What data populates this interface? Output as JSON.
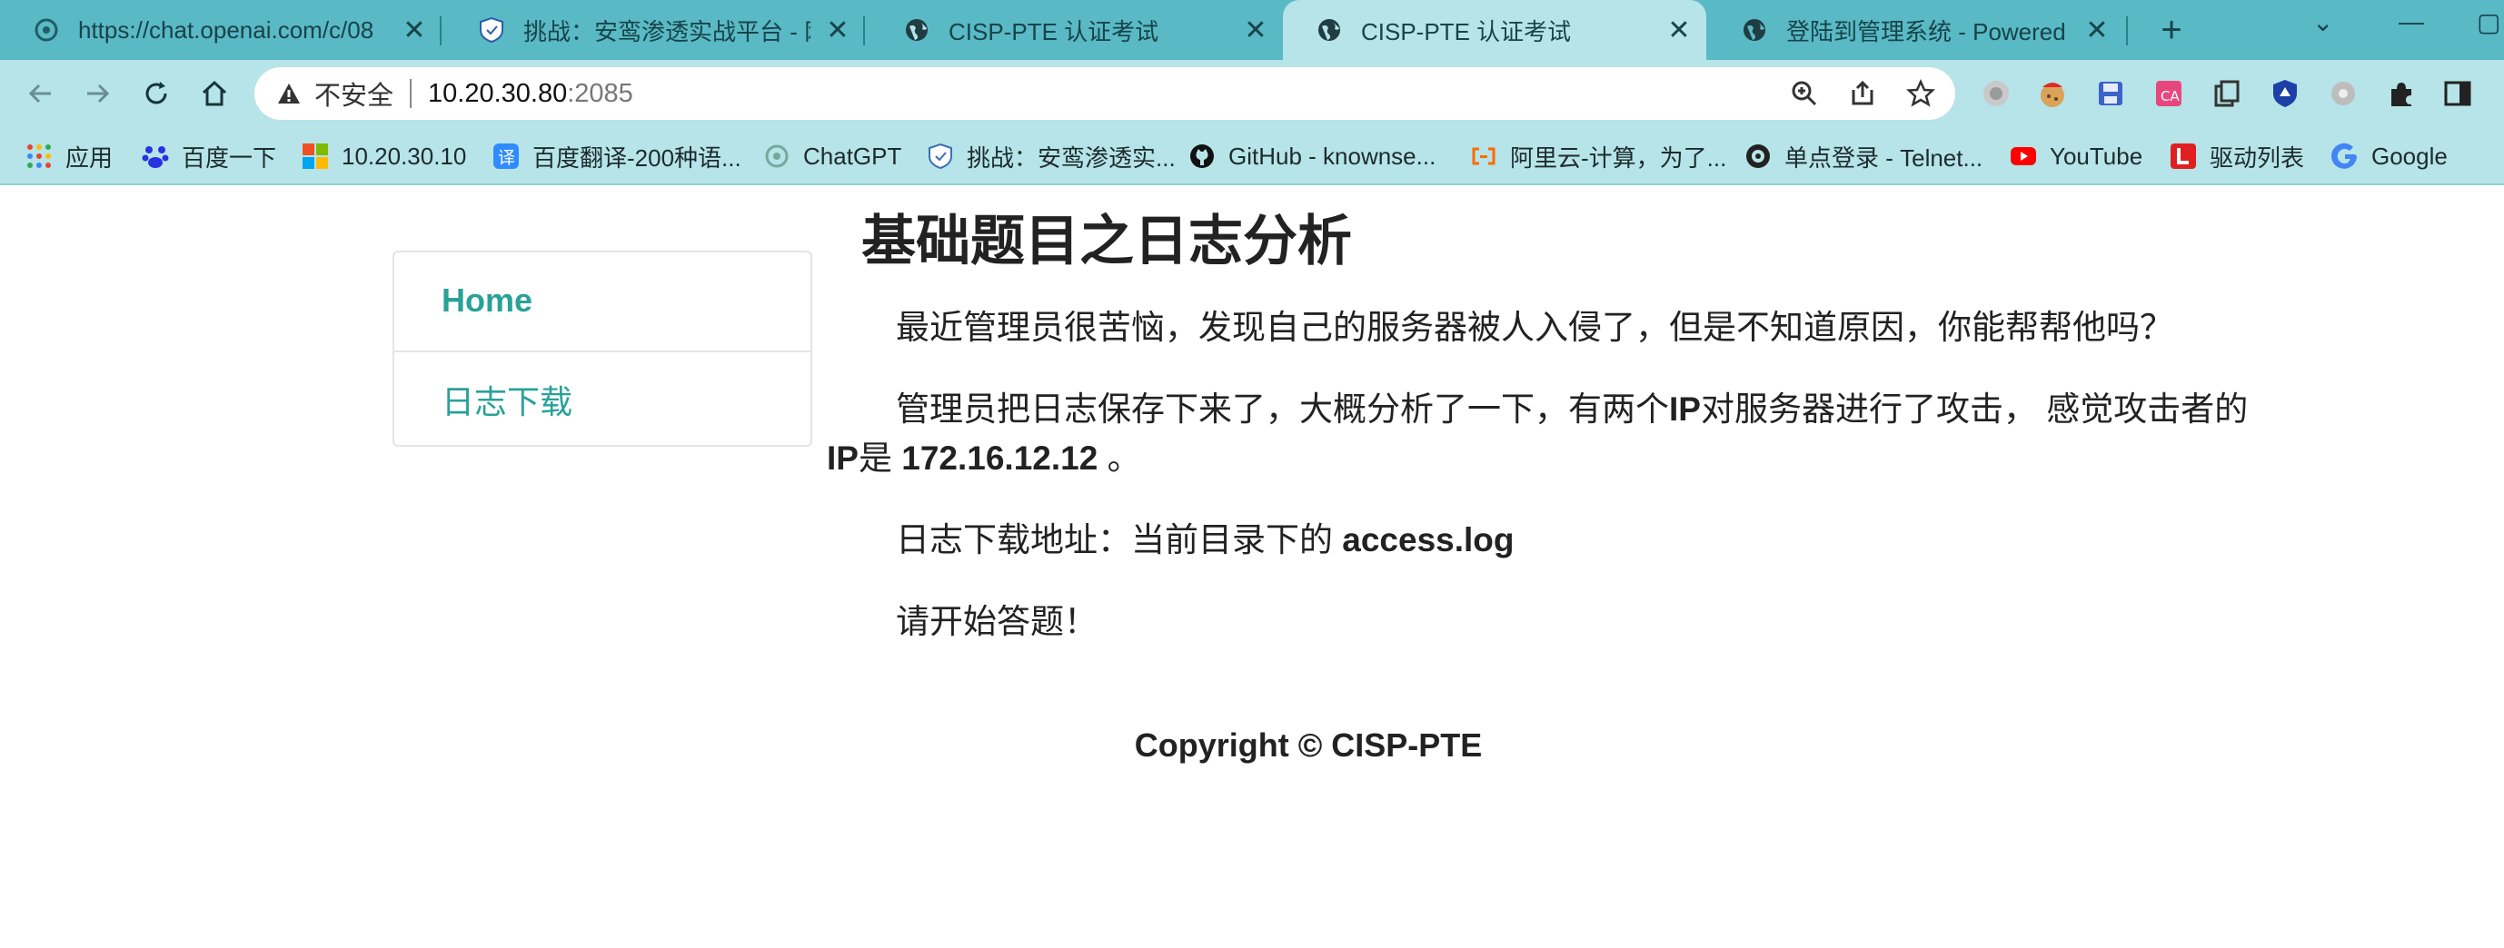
{
  "browser": {
    "tabs": [
      {
        "title": "https://chat.openai.com/c/08",
        "icon": "openai-icon",
        "active": false
      },
      {
        "title": "挑战：安鸾渗透实战平台 - 网络",
        "icon": "shield-icon",
        "active": false
      },
      {
        "title": "CISP-PTE 认证考试",
        "icon": "globe-icon",
        "active": false
      },
      {
        "title": "CISP-PTE 认证考试",
        "icon": "globe-icon",
        "active": true
      },
      {
        "title": "登陆到管理系统 - Powered by",
        "icon": "globe-icon",
        "active": false
      }
    ],
    "new_tab": "+",
    "address": {
      "security_label": "不安全",
      "host": "10.20.30.80",
      "port": ":2085"
    },
    "bookmarks": [
      {
        "label": "应用",
        "icon": "apps-grid-icon",
        "color": "#e94235"
      },
      {
        "label": "百度一下",
        "icon": "baidu-icon",
        "color": "#2932e1"
      },
      {
        "label": "10.20.30.10",
        "icon": "windows-icon",
        "color": "#f25022"
      },
      {
        "label": "百度翻译-200种语...",
        "icon": "baidu-translate-icon",
        "color": "#2f8bff"
      },
      {
        "label": "ChatGPT",
        "icon": "openai-icon",
        "color": "#74aa9c"
      },
      {
        "label": "挑战：安鸾渗透实...",
        "icon": "shield-icon",
        "color": "#3b6fb6"
      },
      {
        "label": "GitHub - knownse...",
        "icon": "github-icon",
        "color": "#111111"
      },
      {
        "label": "阿里云-计算，为了...",
        "icon": "aliyun-icon",
        "color": "#ff6a00"
      },
      {
        "label": "单点登录 - Telnet...",
        "icon": "telnet-icon",
        "color": "#222222"
      },
      {
        "label": "YouTube",
        "icon": "youtube-icon",
        "color": "#ff0000"
      },
      {
        "label": "驱动列表",
        "icon": "driver-list-icon",
        "color": "#e02020"
      },
      {
        "label": "Google",
        "icon": "google-icon",
        "color": "#4285f4"
      }
    ]
  },
  "sidebar": {
    "items": [
      {
        "label": "Home"
      },
      {
        "label": "日志下载"
      }
    ]
  },
  "main": {
    "title": "基础题目之日志分析",
    "para1": "最近管理员很苦恼，发现自己的服务器被人入侵了，但是不知道原因，你能帮帮他吗？",
    "para2_a": "管理员把日志保存下来了，大概分析了一下，有两个",
    "para2_ip": "IP",
    "para2_b": "对服务器进行了攻击， 感觉攻击者的",
    "para2_ip2": "IP",
    "para2_c": "是 ",
    "para2_addr": "172.16.12.12",
    "para2_d": " 。",
    "para3_a": "日志下载地址：当前目录下的 ",
    "para3_file": "access.log",
    "para4": "请开始答题！"
  },
  "footer": {
    "copyright": "Copyright © CISP-PTE"
  },
  "colors": {
    "tabstrip": "#59b9c4",
    "toolbar": "#b6e4e8",
    "link": "#2aa198"
  }
}
